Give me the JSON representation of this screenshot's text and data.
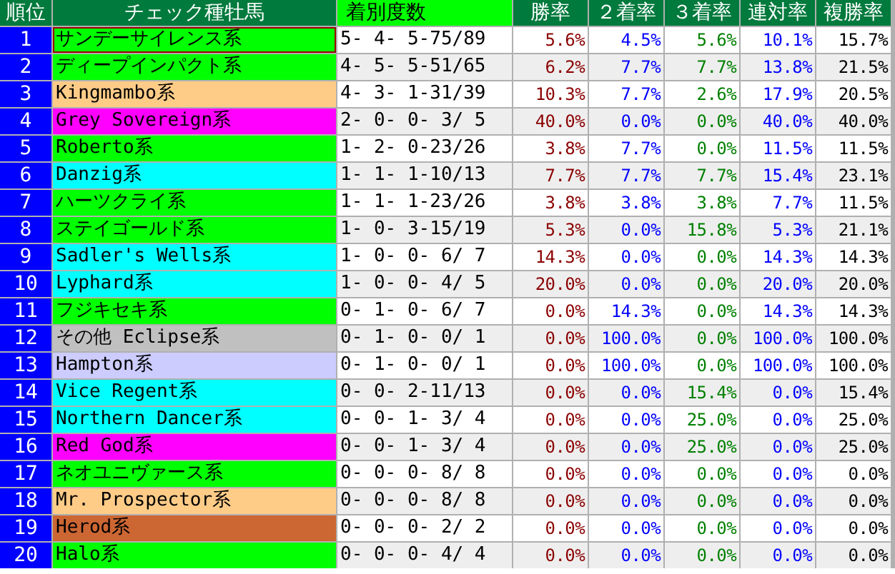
{
  "columns": [
    {
      "label": "順位",
      "highlighted": false
    },
    {
      "label": "チェック種牡馬",
      "highlighted": false
    },
    {
      "label": "着別度数",
      "highlighted": true
    },
    {
      "label": "勝率",
      "highlighted": false
    },
    {
      "label": "２着率",
      "highlighted": false
    },
    {
      "label": "３着率",
      "highlighted": false
    },
    {
      "label": "連対率",
      "highlighted": false
    },
    {
      "label": "複勝率",
      "highlighted": false
    }
  ],
  "rows": [
    {
      "rank": "1",
      "name": "サンデーサイレンス系",
      "color": "#00ff00",
      "selected": true,
      "record": "5- 4- 5-75/89",
      "rates": [
        "5.6%",
        "4.5%",
        "5.6%",
        "10.1%",
        "15.7%"
      ]
    },
    {
      "rank": "2",
      "name": "ディープインパクト系",
      "color": "#00ff00",
      "selected": false,
      "record": "4- 5- 5-51/65",
      "rates": [
        "6.2%",
        "7.7%",
        "7.7%",
        "13.8%",
        "21.5%"
      ]
    },
    {
      "rank": "3",
      "name": "Kingmambo系",
      "color": "#ffcc88",
      "selected": false,
      "record": "4- 3- 1-31/39",
      "rates": [
        "10.3%",
        "7.7%",
        "2.6%",
        "17.9%",
        "20.5%"
      ]
    },
    {
      "rank": "4",
      "name": "Grey Sovereign系",
      "color": "#ff00ff",
      "selected": false,
      "record": "2- 0- 0- 3/ 5",
      "rates": [
        "40.0%",
        "0.0%",
        "0.0%",
        "40.0%",
        "40.0%"
      ]
    },
    {
      "rank": "5",
      "name": "Roberto系",
      "color": "#00ff00",
      "selected": false,
      "record": "1- 2- 0-23/26",
      "rates": [
        "3.8%",
        "7.7%",
        "0.0%",
        "11.5%",
        "11.5%"
      ]
    },
    {
      "rank": "6",
      "name": "Danzig系",
      "color": "#00ffff",
      "selected": false,
      "record": "1- 1- 1-10/13",
      "rates": [
        "7.7%",
        "7.7%",
        "7.7%",
        "15.4%",
        "23.1%"
      ]
    },
    {
      "rank": "7",
      "name": "ハーツクライ系",
      "color": "#00ff00",
      "selected": false,
      "record": "1- 1- 1-23/26",
      "rates": [
        "3.8%",
        "3.8%",
        "3.8%",
        "7.7%",
        "11.5%"
      ]
    },
    {
      "rank": "8",
      "name": "ステイゴールド系",
      "color": "#00ff00",
      "selected": false,
      "record": "1- 0- 3-15/19",
      "rates": [
        "5.3%",
        "0.0%",
        "15.8%",
        "5.3%",
        "21.1%"
      ]
    },
    {
      "rank": "9",
      "name": "Sadler's Wells系",
      "color": "#00ffff",
      "selected": false,
      "record": "1- 0- 0- 6/ 7",
      "rates": [
        "14.3%",
        "0.0%",
        "0.0%",
        "14.3%",
        "14.3%"
      ]
    },
    {
      "rank": "10",
      "name": "Lyphard系",
      "color": "#00ffff",
      "selected": false,
      "record": "1- 0- 0- 4/ 5",
      "rates": [
        "20.0%",
        "0.0%",
        "0.0%",
        "20.0%",
        "20.0%"
      ]
    },
    {
      "rank": "11",
      "name": "フジキセキ系",
      "color": "#00ff00",
      "selected": false,
      "record": "0- 1- 0- 6/ 7",
      "rates": [
        "0.0%",
        "14.3%",
        "0.0%",
        "14.3%",
        "14.3%"
      ]
    },
    {
      "rank": "12",
      "name": "その他 Eclipse系",
      "color": "#c0c0c0",
      "selected": false,
      "record": "0- 1- 0- 0/ 1",
      "rates": [
        "0.0%",
        "100.0%",
        "0.0%",
        "100.0%",
        "100.0%"
      ]
    },
    {
      "rank": "13",
      "name": "Hampton系",
      "color": "#ccccff",
      "selected": false,
      "record": "0- 1- 0- 0/ 1",
      "rates": [
        "0.0%",
        "100.0%",
        "0.0%",
        "100.0%",
        "100.0%"
      ]
    },
    {
      "rank": "14",
      "name": "Vice Regent系",
      "color": "#00ffff",
      "selected": false,
      "record": "0- 0- 2-11/13",
      "rates": [
        "0.0%",
        "0.0%",
        "15.4%",
        "0.0%",
        "15.4%"
      ]
    },
    {
      "rank": "15",
      "name": "Northern Dancer系",
      "color": "#00ffff",
      "selected": false,
      "record": "0- 0- 1- 3/ 4",
      "rates": [
        "0.0%",
        "0.0%",
        "25.0%",
        "0.0%",
        "25.0%"
      ]
    },
    {
      "rank": "16",
      "name": "Red God系",
      "color": "#ff00ff",
      "selected": false,
      "record": "0- 0- 1- 3/ 4",
      "rates": [
        "0.0%",
        "0.0%",
        "25.0%",
        "0.0%",
        "25.0%"
      ]
    },
    {
      "rank": "17",
      "name": "ネオユニヴァース系",
      "color": "#00ff00",
      "selected": false,
      "record": "0- 0- 0- 8/ 8",
      "rates": [
        "0.0%",
        "0.0%",
        "0.0%",
        "0.0%",
        "0.0%"
      ]
    },
    {
      "rank": "18",
      "name": "Mr. Prospector系",
      "color": "#ffcc88",
      "selected": false,
      "record": "0- 0- 0- 8/ 8",
      "rates": [
        "0.0%",
        "0.0%",
        "0.0%",
        "0.0%",
        "0.0%"
      ]
    },
    {
      "rank": "19",
      "name": "Herod系",
      "color": "#cc6633",
      "selected": false,
      "record": "0- 0- 0- 2/ 2",
      "rates": [
        "0.0%",
        "0.0%",
        "0.0%",
        "0.0%",
        "0.0%"
      ]
    },
    {
      "rank": "20",
      "name": "Halo系",
      "color": "#00ff00",
      "selected": false,
      "record": "0- 0- 0- 4/ 4",
      "rates": [
        "0.0%",
        "0.0%",
        "0.0%",
        "0.0%",
        "0.0%"
      ]
    }
  ]
}
